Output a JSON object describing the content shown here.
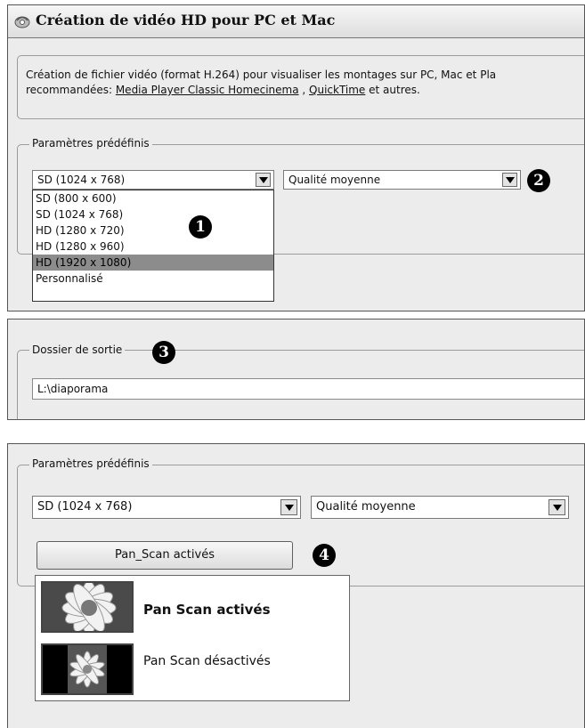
{
  "window": {
    "title": "Création de vidéo HD pour PC et Mac"
  },
  "description": {
    "line1": "Création de fichier vidéo (format H.264) pour visualiser les montages sur PC, Mac et Pla",
    "line2_prefix": "recommandées: ",
    "link1": "Media Player Classic Homecinema",
    "sep": " , ",
    "link2": "QuickTime",
    "line2_suffix": " et autres."
  },
  "presets": {
    "legend": "Paramètres prédéfinis",
    "resolution_value": "SD (1024 x 768)",
    "quality_value": "Qualité moyenne",
    "options": [
      "SD (800 x 600)",
      "SD (1024 x 768)",
      "HD (1280 x 720)",
      "HD (1280 x 960)",
      "HD (1920 x 1080)",
      "Personnalisé"
    ],
    "highlighted_option": "HD (1920 x 1080)"
  },
  "output": {
    "legend": "Dossier de sortie",
    "path": "L:\\diaporama"
  },
  "presets2": {
    "legend": "Paramètres prédéfinis",
    "resolution_value": "SD (1024 x 768)",
    "quality_value": "Qualité moyenne",
    "pan_button": "Pan_Scan activés",
    "menu": {
      "enabled": "Pan  Scan activés",
      "disabled": "Pan  Scan désactivés"
    }
  },
  "badges": {
    "b1": "1",
    "b2": "2",
    "b3": "3",
    "b4": "4"
  },
  "icons": {
    "window": "app-icon",
    "dropdown": "chevron-down-icon",
    "flower": "flower-thumbnail-icon"
  },
  "colors": {
    "panel": "#ececec",
    "selection": "#8c8c8c",
    "badge": "#000000"
  }
}
